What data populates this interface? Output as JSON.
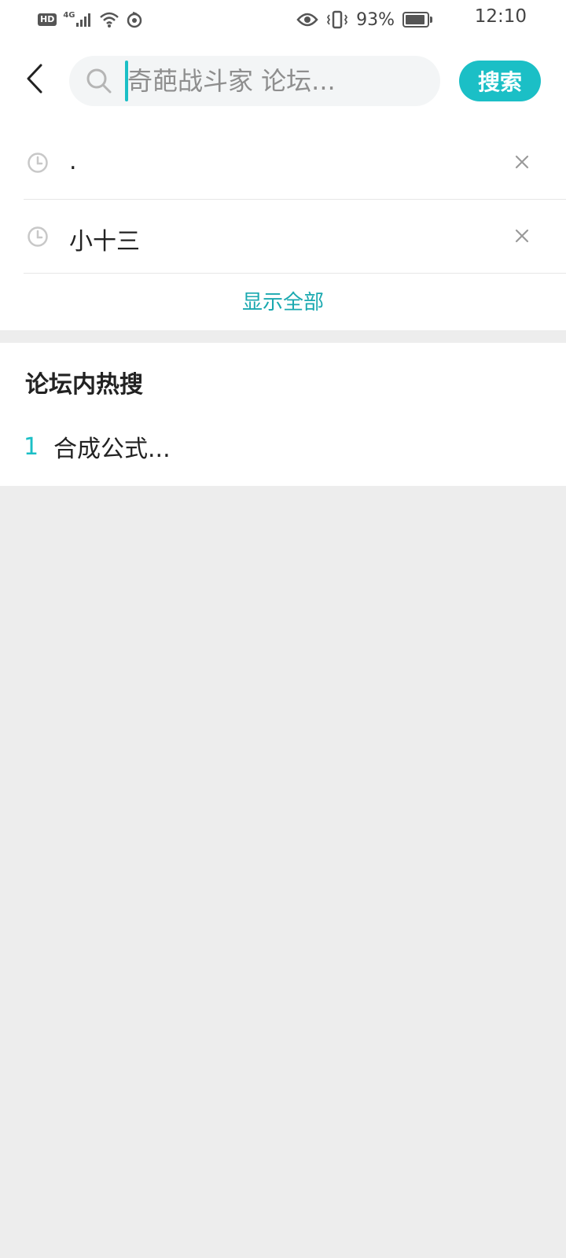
{
  "status_bar": {
    "hd": "HD",
    "network": "4G",
    "battery_percent": "93%",
    "battery_level": 0.93,
    "time": "12:10"
  },
  "header": {
    "search_placeholder": "奇葩战斗家 论坛...",
    "search_button_label": "搜索"
  },
  "history": {
    "items": [
      {
        "text": "."
      },
      {
        "text": "小十三"
      }
    ],
    "show_all_label": "显示全部"
  },
  "hot": {
    "title": "论坛内热搜",
    "items": [
      {
        "rank": "1",
        "text": "合成公式..."
      }
    ]
  },
  "colors": {
    "accent": "#1bbfc6",
    "background": "#ededed"
  }
}
